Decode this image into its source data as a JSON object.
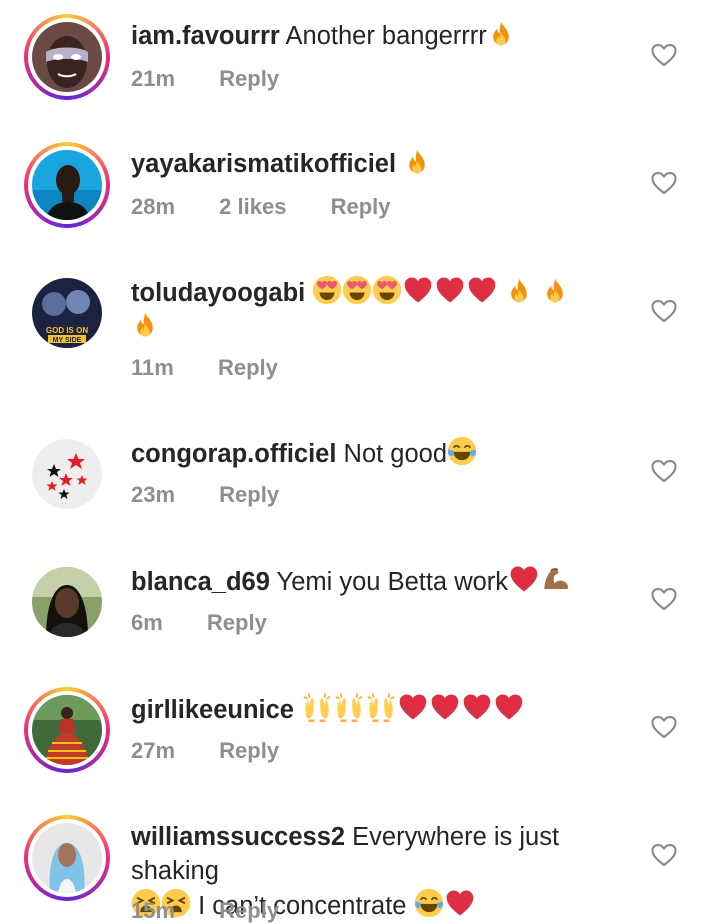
{
  "comments": [
    {
      "username": "iam.favourrr",
      "text": "Another bangerrrr",
      "emoji": [
        "fire"
      ],
      "time": "21m",
      "likes": "",
      "reply": "Reply",
      "avatar": "avatar-mask"
    },
    {
      "username": "yayakarismatikofficiel",
      "text": "",
      "emoji": [
        "fire"
      ],
      "time": "28m",
      "likes": "2 likes",
      "reply": "Reply",
      "avatar": "avatar-person-blue"
    },
    {
      "username": "toludayoogabi",
      "text": "",
      "emoji": [
        "heart-eyes",
        "heart-eyes",
        "heart-eyes",
        "red-heart",
        "red-heart",
        "red-heart",
        "fire",
        "fire",
        "fire"
      ],
      "time": "11m",
      "likes": "",
      "reply": "Reply",
      "avatar": "avatar-god-is-on-my-side",
      "avatar_text": "GOD IS ON MY SIDE"
    },
    {
      "username": "congorap.officiel",
      "text": "Not good",
      "emoji": [
        "tears-of-joy"
      ],
      "time": "23m",
      "likes": "",
      "reply": "Reply",
      "avatar": "avatar-stars"
    },
    {
      "username": "blanca_d69",
      "text": "Yemi you Betta work",
      "emoji": [
        "red-heart",
        "flexed-biceps"
      ],
      "time": "6m",
      "likes": "",
      "reply": "Reply",
      "avatar": "avatar-woman"
    },
    {
      "username": "girllikeeunice",
      "text": "",
      "emoji": [
        "raising-hands",
        "raising-hands",
        "raising-hands",
        "red-heart",
        "red-heart",
        "red-heart",
        "red-heart"
      ],
      "time": "27m",
      "likes": "",
      "reply": "Reply",
      "avatar": "avatar-dress"
    },
    {
      "username": "williamssuccess2",
      "text": "Everywhere is just shaking",
      "text2": "I can’t concentrate",
      "emoji": [
        "weary",
        "weary"
      ],
      "emoji2": [
        "tears-of-joy",
        "red-heart"
      ],
      "time": "15m",
      "likes": "",
      "reply": "Reply",
      "avatar": "avatar-blue-hair"
    }
  ],
  "colors": {
    "username": "#262626",
    "meta": "#8e8e8e",
    "heart_outline": "#8e8e8e",
    "fire": "#f97316",
    "red_heart": "#dd2e44",
    "emoji_yellow": "#ffcc4d"
  }
}
